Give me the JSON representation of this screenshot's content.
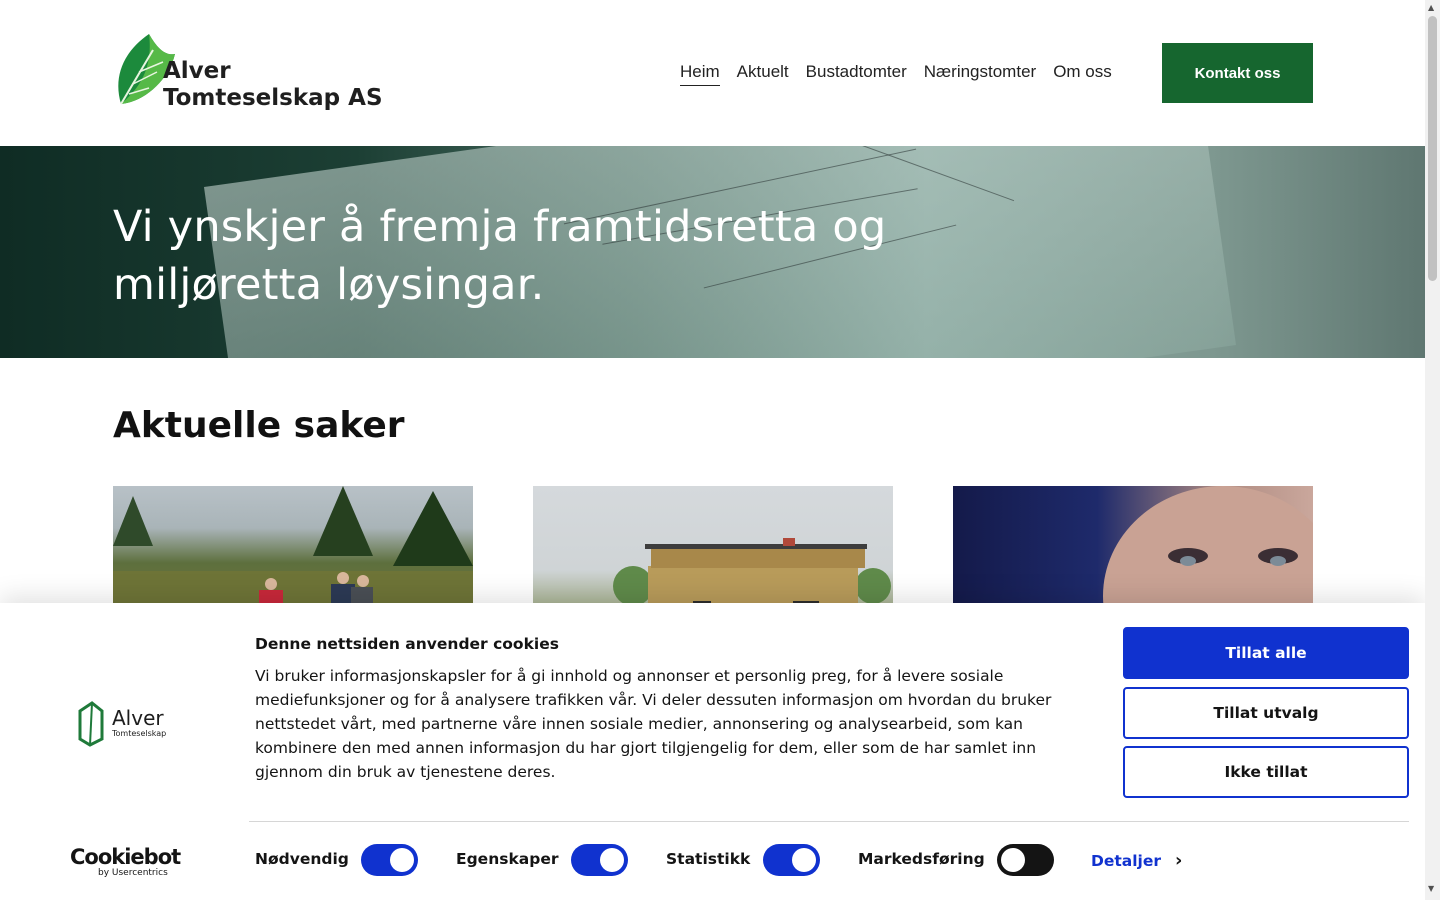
{
  "header": {
    "logo": {
      "line1": "Alver",
      "line2": "Tomteselskap AS",
      "icon": "leaf-logo-icon"
    },
    "nav": [
      {
        "label": "Heim",
        "active": true
      },
      {
        "label": "Aktuelt",
        "active": false
      },
      {
        "label": "Bustadtomter",
        "active": false
      },
      {
        "label": "Næringstomter",
        "active": false
      },
      {
        "label": "Om oss",
        "active": false
      }
    ],
    "cta_label": "Kontakt oss",
    "accent_color": "#16662f"
  },
  "hero": {
    "title": "Vi ynskjer å fremja framtidsretta og miljøretta løysingar."
  },
  "news": {
    "title": "Aktuelle saker",
    "cards": [
      {
        "image": "people-in-forest-photo"
      },
      {
        "image": "modern-wooden-house-photo"
      },
      {
        "image": "woman-portrait-photo"
      }
    ]
  },
  "cookie_banner": {
    "logo": {
      "name": "Alver",
      "sub": "Tomteselskap"
    },
    "title": "Denne nettsiden anvender cookies",
    "body": "Vi bruker informasjonskapsler for å gi innhold og annonser et personlig preg, for å levere sosiale mediefunksjoner og for å analysere trafikken vår. Vi deler dessuten informasjon om hvordan du bruker nettstedet vårt, med partnerne våre innen sosiale medier, annonsering og analysearbeid, som kan kombinere den med annen informasjon du har gjort tilgjengelig for dem, eller som de har samlet inn gjennom din bruk av tjenestene deres.",
    "buttons": {
      "allow_all": "Tillat alle",
      "allow_selection": "Tillat utvalg",
      "deny": "Ikke tillat"
    },
    "toggles": [
      {
        "label": "Nødvendig",
        "on": true
      },
      {
        "label": "Egenskaper",
        "on": true
      },
      {
        "label": "Statistikk",
        "on": true
      },
      {
        "label": "Markedsføring",
        "on": false
      }
    ],
    "details_label": "Detaljer",
    "cookiebot": {
      "brand": "Cookiebot",
      "by": "by Usercentrics"
    },
    "accent_color": "#1032cf"
  }
}
